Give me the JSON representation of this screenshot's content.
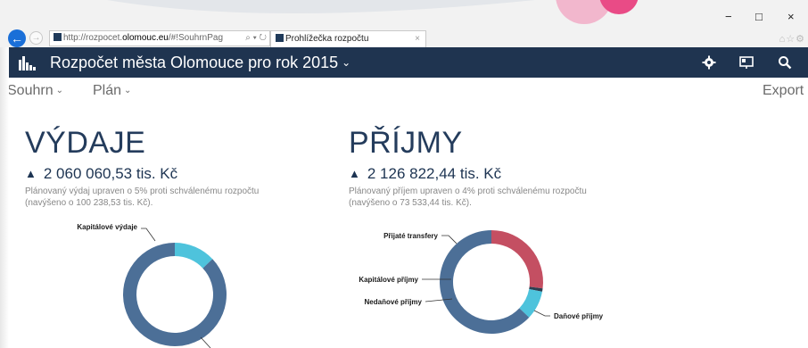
{
  "browser": {
    "address_prefix": "http://rozpocet.",
    "address_host": "olomouc.eu",
    "address_suffix": "/#!SouhrnPag",
    "address_tools": "⌕ ▾ ↻",
    "tab_title": "Prohlížečka rozpočtu",
    "tab_close": "×",
    "minimize": "−",
    "maximize": "□",
    "close": "×",
    "toolbar_icons": "⌂☆⚙"
  },
  "app": {
    "title": "Rozpočet města Olomouce pro rok 2015",
    "title_chevron": "⌄"
  },
  "subnav": {
    "items": [
      {
        "label": "Souhrn",
        "chevron": "⌄"
      },
      {
        "label": "Plán",
        "chevron": "⌄"
      }
    ],
    "export_label": "Export"
  },
  "expenses": {
    "title": "VÝDAJE",
    "arrow": "▲",
    "amount": "2 060 060,53 tis. Kč",
    "note_line1": "Plánovaný výdaj upraven o 5% proti schválenému rozpočtu",
    "note_line2": "(navýšeno o 100 238,53 tis. Kč).",
    "chart": {
      "type": "pie",
      "labels": [
        "Kapitálové výdaje"
      ],
      "slices": [
        {
          "name": "Kapitálové výdaje",
          "fraction": 0.13,
          "color": "#4ec3dc"
        },
        {
          "name": "",
          "fraction": 0.87,
          "color": "#4c6f97"
        }
      ]
    }
  },
  "revenues": {
    "title": "PŘÍJMY",
    "arrow": "▲",
    "amount": "2 126 822,44 tis. Kč",
    "note_line1": "Plánovaný příjem upraven o 4% proti schválenému rozpočtu",
    "note_line2": "(navýšeno o 73 533,44 tis. Kč).",
    "chart": {
      "type": "pie",
      "labels": [
        "Přijaté transfery",
        "Kapitálové příjmy",
        "Nedaňové příjmy",
        "Daňové příjmy"
      ],
      "slices": [
        {
          "name": "Přijaté transfery",
          "fraction": 0.27,
          "color": "#c44f62"
        },
        {
          "name": "Kapitálové příjmy",
          "fraction": 0.01,
          "color": "#2d3e50"
        },
        {
          "name": "Nedaňové příjmy",
          "fraction": 0.09,
          "color": "#4ec3dc"
        },
        {
          "name": "Daňové příjmy",
          "fraction": 0.63,
          "color": "#4c6f97"
        }
      ]
    }
  },
  "chart_data": [
    {
      "type": "pie",
      "labels": [
        "Kapitálové výdaje",
        ""
      ],
      "values": [
        0.13,
        0.87
      ]
    },
    {
      "type": "pie",
      "labels": [
        "Přijaté transfery",
        "Kapitálové příjmy",
        "Nedaňové příjmy",
        "Daňové příjmy"
      ],
      "values": [
        0.27,
        0.01,
        0.09,
        0.63
      ]
    }
  ]
}
